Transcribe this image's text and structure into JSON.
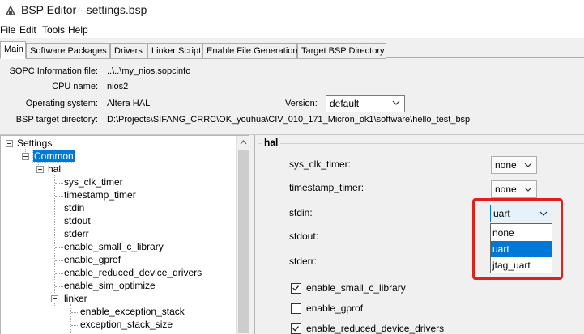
{
  "window": {
    "title": "BSP Editor - settings.bsp"
  },
  "menu": {
    "items": [
      "File",
      "Edit",
      "Tools",
      "Help"
    ]
  },
  "tabs": [
    "Main",
    "Software Packages",
    "Drivers",
    "Linker Script",
    "Enable File Generation",
    "Target BSP Directory"
  ],
  "info": {
    "sopc_label": "SOPC Information file:",
    "sopc_value": "..\\..\\my_nios.sopcinfo",
    "cpu_label": "CPU name:",
    "cpu_value": "nios2",
    "os_label": "Operating system:",
    "os_value": "Altera HAL",
    "version_label": "Version:",
    "version_value": "default",
    "bsp_label": "BSP target directory:",
    "bsp_value": "D:\\Projects\\SIFANG_CRRC\\OK_youhua\\CIV_010_171_Micron_ok1\\software\\hello_test_bsp"
  },
  "tree": {
    "root": "Settings",
    "common": "Common",
    "hal": "hal",
    "hal_children": [
      "sys_clk_timer",
      "timestamp_timer",
      "stdin",
      "stdout",
      "stderr",
      "enable_small_c_library",
      "enable_gprof",
      "enable_reduced_device_drivers",
      "enable_sim_optimize"
    ],
    "linker": "linker",
    "linker_children": [
      "enable_exception_stack",
      "exception_stack_size"
    ]
  },
  "settings": {
    "group_title": "hal",
    "sys_clk_timer_label": "sys_clk_timer:",
    "sys_clk_timer_value": "none",
    "timestamp_timer_label": "timestamp_timer:",
    "timestamp_timer_value": "none",
    "stdin_label": "stdin:",
    "stdin_value": "uart",
    "stdout_label": "stdout:",
    "stderr_label": "stderr:",
    "stdin_options": [
      "none",
      "uart",
      "jtag_uart"
    ],
    "stdin_highlighted": "uart",
    "checks": [
      {
        "label": "enable_small_c_library",
        "checked": true
      },
      {
        "label": "enable_gprof",
        "checked": false
      },
      {
        "label": "enable_reduced_device_drivers",
        "checked": true
      }
    ]
  },
  "colors": {
    "selection": "#0078d7",
    "highlight_box": "#e0201b"
  }
}
